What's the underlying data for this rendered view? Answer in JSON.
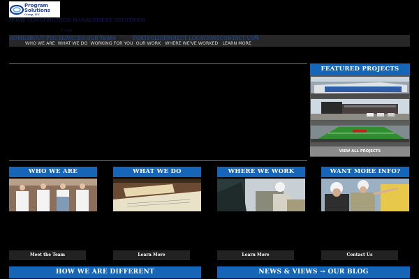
{
  "header": {
    "logo_title_1": "Program",
    "logo_title_2": "Solutions",
    "logo_sub": "Group, LLC",
    "tagline_home": "HOME",
    "tagline": "CONSTRUCTION MANAGEMENT SOLUTIONS",
    "email": "E-mail"
  },
  "nav": {
    "top_items": [
      "HOME",
      "ABOUT PSG",
      "SERVICES",
      "OUR TEAM",
      "BLOG",
      "PORTFOLIO",
      "PROJECT LOCATIONS",
      "CONTACT US"
    ],
    "sub_items": [
      "WHO WE ARE",
      "WHAT WE DO",
      "WORKING FOR YOU",
      "OUR WORK",
      "WHERE WE'VE WORKED",
      "LEARN MORE"
    ]
  },
  "featured": {
    "heading": "FEATURED PROJECTS",
    "view_all": "VIEW ALL PROJECTS"
  },
  "columns": [
    {
      "heading": "WHO WE ARE",
      "button": "Meet the Team"
    },
    {
      "heading": "WHAT WE DO",
      "button": "Learn More"
    },
    {
      "heading": "WHERE WE WORK",
      "button": "Learn More"
    },
    {
      "heading": "WANT MORE INFO?",
      "button": "Contact Us"
    }
  ],
  "bottom": {
    "different": "HOW WE ARE DIFFERENT",
    "news": "NEWS & VIEWS → OUR BLOG"
  },
  "colors": {
    "accent": "#1565b8",
    "nav_bg": "#272727"
  }
}
